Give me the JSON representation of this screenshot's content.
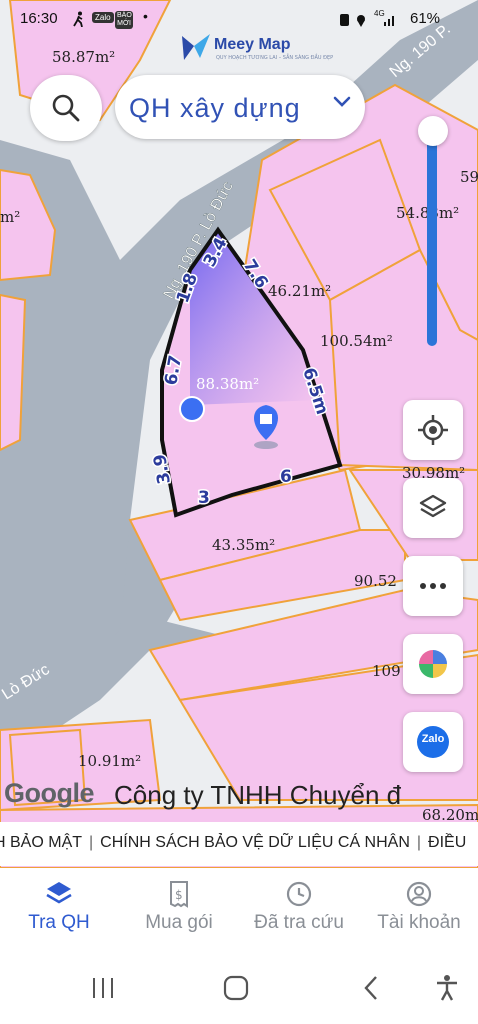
{
  "status_bar": {
    "time": "16:30",
    "zalo_badge": "Zalo",
    "baomoi_badge": "BÁO MỚI",
    "battery": "61%",
    "network": "4G"
  },
  "app": {
    "brand": "Meey Map",
    "tagline": "QUY HOẠCH TƯƠNG LAI – SẴN SÀNG ĐẦU ĐẸP"
  },
  "header": {
    "layer_select_value": "QH xây dựng"
  },
  "map": {
    "parcel_areas": [
      "58.87m²",
      "54.83m²",
      "46.21m²",
      "100.54m²",
      "88.38m²",
      "30.98m²",
      "43.35m²",
      "90.52",
      "109",
      "10.91m²",
      "68.20m",
      "m²",
      "59"
    ],
    "street_labels": [
      "Ng. 190 P. Lò Đức",
      "Lò Đức",
      "Ng. 190 P."
    ],
    "edge_lengths": [
      "3.4",
      "1.8",
      "6.7",
      "3.9",
      "3",
      "6",
      "6.5m",
      "7.6"
    ],
    "attribution": "Google",
    "company_text": "Công ty TNHH Chuyển đ"
  },
  "footer_links": [
    "H BẢO MẬT",
    "CHÍNH SÁCH BẢO VỆ DỮ LIỆU CÁ NHÂN",
    "ĐIỀU"
  ],
  "side_buttons": {
    "zalo_label": "Zalo"
  },
  "bottom_nav": [
    {
      "label": "Tra QH",
      "icon": "layers-icon",
      "active": true
    },
    {
      "label": "Mua gói",
      "icon": "receipt-icon",
      "active": false
    },
    {
      "label": "Đã tra cứu",
      "icon": "clock-icon",
      "active": false
    },
    {
      "label": "Tài khoản",
      "icon": "account-icon",
      "active": false
    }
  ],
  "colors": {
    "parcel_fill": "#f5c4ee",
    "parcel_border": "#f0a23a",
    "road": "#a9b3bf",
    "accent": "#2f5bd0"
  }
}
